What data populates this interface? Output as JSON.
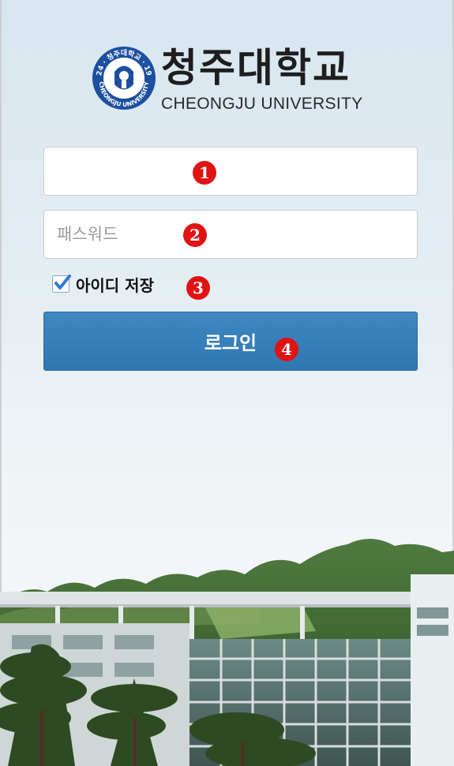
{
  "header": {
    "logo_text_ko": "청주대학교",
    "logo_text_en": "CHEONGJU UNIVERSITY",
    "emblem_top_text": "1924 · 청주대학교 · 1947",
    "emblem_bottom_text": "CHEONGJU UNIVERSITY"
  },
  "login": {
    "id_value": "",
    "password_placeholder": "패스워드",
    "remember_label": "아이디 저장",
    "remember_checked": true,
    "login_button_label": "로그인"
  },
  "markers": [
    "1",
    "2",
    "3",
    "4"
  ],
  "colors": {
    "button": "#3a82bd",
    "marker": "#e11212",
    "emblem_blue": "#1c4fa0"
  },
  "icons": [
    "university-emblem-icon",
    "checkbox-checked-icon"
  ]
}
